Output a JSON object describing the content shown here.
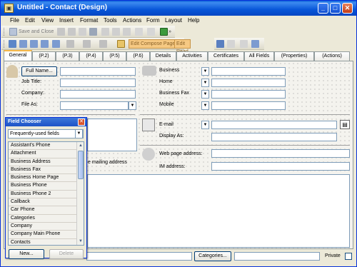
{
  "window": {
    "title": "Untitled - Contact  (Design)"
  },
  "menu": [
    "File",
    "Edit",
    "View",
    "Insert",
    "Format",
    "Tools",
    "Actions",
    "Form",
    "Layout",
    "Help"
  ],
  "toolbar1": {
    "save_and_close": "Save and Close"
  },
  "toolbar2": {
    "edit_compose": "Edit Compose Page",
    "edit_read": "Edit Read Page"
  },
  "tabs": [
    "General",
    "(P.2)",
    "(P.3)",
    "(P.4)",
    "(P.5)",
    "(P.6)",
    "Details",
    "Activities",
    "Certificates",
    "All Fields",
    "(Properties)",
    "(Actions)"
  ],
  "form": {
    "full_name_button": "Full Name...",
    "job_title": "Job Title:",
    "company": "Company:",
    "file_as": "File As:",
    "phones": [
      "Business",
      "Home",
      "Business Fax",
      "Mobile"
    ],
    "email": "E-mail",
    "display_as": "Display As:",
    "web_page": "Web page address:",
    "im_address": "IM address:",
    "mailing_address_tail": "e mailing address",
    "categories_button": "Categories...",
    "private_label": "Private"
  },
  "field_chooser": {
    "title": "Field Chooser",
    "selected_set": "Frequently-used fields",
    "items": [
      "Assistant's Phone",
      "Attachment",
      "Business Address",
      "Business Fax",
      "Business Home Page",
      "Business Phone",
      "Business Phone 2",
      "Callback",
      "Car Phone",
      "Categories",
      "Company",
      "Company Main Phone",
      "Contacts"
    ],
    "new_button": "New...",
    "delete_button": "Delete"
  }
}
